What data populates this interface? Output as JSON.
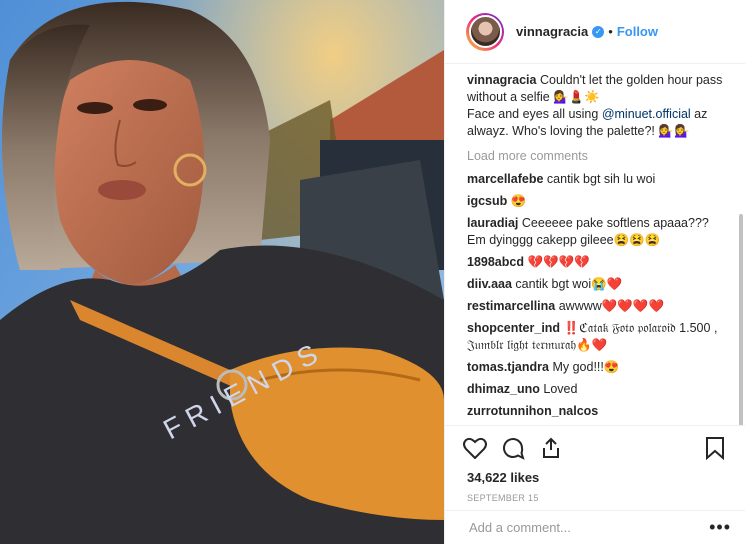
{
  "post": {
    "username": "vinnagracia",
    "follow_label": "Follow",
    "separator": "•",
    "caption_username": "vinnagracia",
    "caption_line1": "Couldn't let the golden hour pass without a selfie 💁‍♀️💄☀️",
    "caption_line2_pre": "Face and eyes all using ",
    "caption_mention": "@minuet.official",
    "caption_line2_post": " az alwayz. Who's loving the palette?! 💁‍♀️💁‍♀️",
    "load_more": "Load more comments",
    "likes": "34,622 likes",
    "date": "SEPTEMBER 15",
    "add_comment_placeholder": "Add a comment...",
    "options": "•••"
  },
  "comments": [
    {
      "user": "marcellafebe",
      "text": "cantik bgt sih lu woi"
    },
    {
      "user": "igcsub",
      "text": "😍"
    },
    {
      "user": "lauradiaj",
      "text": "Ceeeeee pake softlens apaaa??? Em dyinggg cakepp gileee😫😫😫"
    },
    {
      "user": "1898abcd",
      "text": "💔💔💔💔"
    },
    {
      "user": "diiv.aaa",
      "text": "cantik bgt woi😭❤️"
    },
    {
      "user": "restimarcellina",
      "text": "awwww❤️❤️❤️❤️"
    },
    {
      "user": "shopcenter_ind",
      "text": "‼️ℭ𝔞𝔱𝔞𝔨 𝔉𝔬𝔱𝔬 𝔭𝔬𝔩𝔞𝔯𝔬𝔦𝔡 1.500 , 𝔍𝔲𝔪𝔟𝔩𝔯 𝔩𝔦𝔤𝔥𝔱 𝔱𝔢𝔯𝔪𝔲𝔯𝔞𝔥🔥❤️"
    },
    {
      "user": "tomas.tjandra",
      "text": "My god!!!😍"
    },
    {
      "user": "dhimaz_uno",
      "text": "Loved"
    },
    {
      "user": "zurrotunnihon_nalcos",
      "text": ""
    }
  ],
  "icons": {
    "like": "heart-icon",
    "comment": "comment-icon",
    "share": "share-icon",
    "save": "bookmark-icon"
  },
  "colors": {
    "link": "#3897f0",
    "muted": "#999999",
    "text": "#262626"
  }
}
